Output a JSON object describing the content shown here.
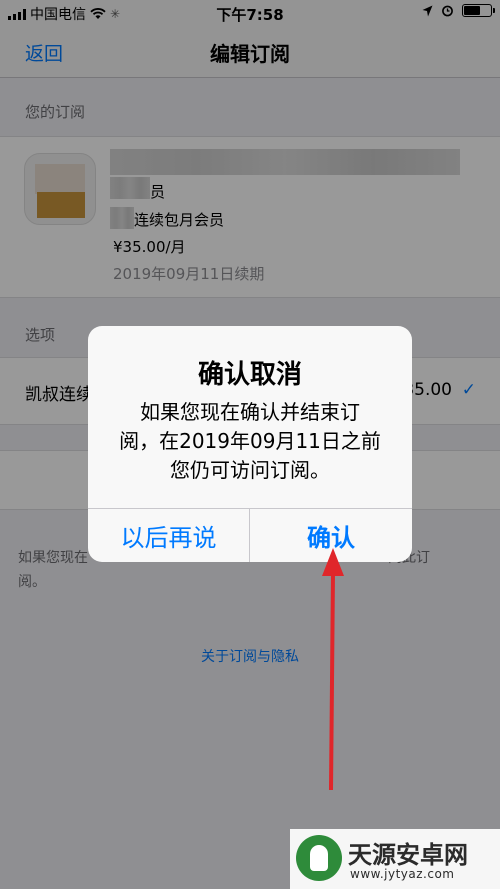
{
  "status_bar": {
    "carrier": "中国电信",
    "time": "下午7:58"
  },
  "nav": {
    "back_label": "返回",
    "title": "编辑订阅"
  },
  "subscriptions": {
    "section_title": "您的订阅",
    "line1": "员",
    "line2": "连续包月会员",
    "price": "¥35.00/月",
    "renewal_date": "2019年09月11日续期"
  },
  "options": {
    "section_title": "选项",
    "item_label": "凯叔连续",
    "item_price": "35.00"
  },
  "footer": {
    "note_line1": "如果您现在",
    "note_line1_end": "问此订",
    "note_line2": "阅。",
    "privacy_link": "关于订阅与隐私"
  },
  "alert": {
    "title": "确认取消",
    "message_line1": "如果您现在确认并结束订",
    "message_line2": "阅，在2019年09月11日之前",
    "message_line3": "您仍可访问订阅。",
    "later_label": "以后再说",
    "confirm_label": "确认"
  },
  "watermark": {
    "text": "天源安卓网",
    "url": "www.jytyaz.com"
  },
  "colors": {
    "accent": "#007aff",
    "annotation_arrow": "#e0262a",
    "watermark_logo": "#2e8b3a"
  },
  "icons": [
    "signal-icon",
    "wifi-icon",
    "location-icon",
    "alarm-icon",
    "battery-icon",
    "checkmark-icon"
  ]
}
